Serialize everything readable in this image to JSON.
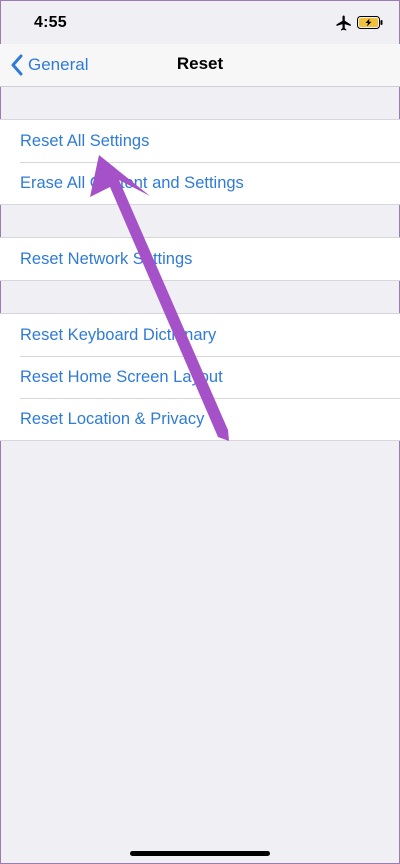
{
  "status_bar": {
    "time": "4:55",
    "icons": [
      "airplane-icon",
      "battery-charging-icon"
    ],
    "battery_color": "#f2c13c"
  },
  "nav": {
    "back_label": "General",
    "title": "Reset"
  },
  "groups": [
    {
      "items": [
        {
          "label": "Reset All Settings"
        },
        {
          "label": "Erase All Content and Settings"
        }
      ]
    },
    {
      "items": [
        {
          "label": "Reset Network Settings"
        }
      ]
    },
    {
      "items": [
        {
          "label": "Reset Keyboard Dictionary"
        },
        {
          "label": "Reset Home Screen Layout"
        },
        {
          "label": "Reset Location & Privacy"
        }
      ]
    }
  ],
  "colors": {
    "accent": "#2f7bd6",
    "annotation_arrow": "#a552c9",
    "background": "#efeff4"
  }
}
